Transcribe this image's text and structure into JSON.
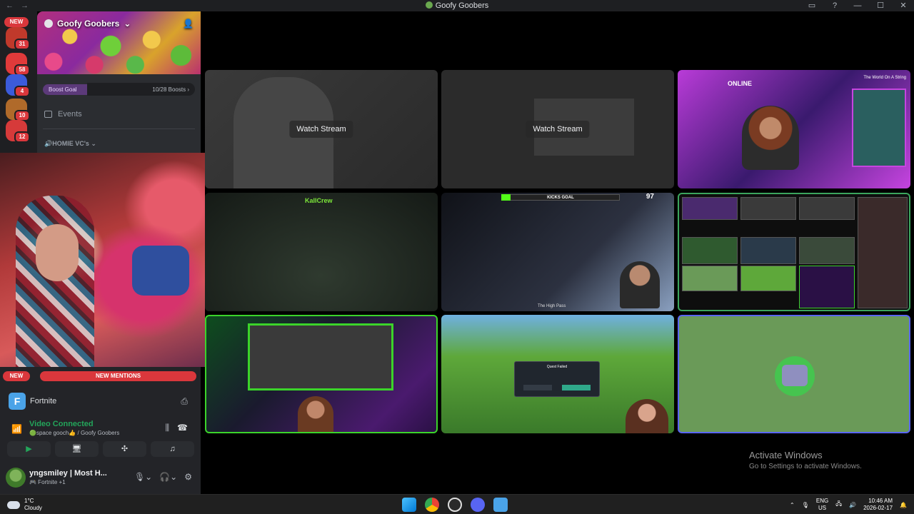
{
  "titlebar": {
    "back": "←",
    "forward": "→",
    "title": "Goofy Goobers",
    "inbox_icon": "inbox-icon",
    "help": "?",
    "minimize": "—",
    "maximize": "☐",
    "close": "✕"
  },
  "rail": {
    "new_label": "NEW",
    "servers": [
      {
        "badge": "31",
        "color": "#c0392b"
      },
      {
        "badge": "58",
        "color": "#e03a3a"
      },
      {
        "badge": "4",
        "color": "#3b5bdb"
      },
      {
        "badge": "10",
        "color": "#b06a2a"
      },
      {
        "badge": "12",
        "color": "#d63a3a"
      }
    ]
  },
  "sidebar": {
    "server_name": "Goofy Goobers",
    "invite_icon": "add-member-icon",
    "boost_goal_label": "Boost Goal",
    "boost_count": "10/28 Boosts ›",
    "boost_progress": 0.357,
    "events_label": "Events",
    "category_label": "🔊HOMIE VC's ⌄"
  },
  "lower": {
    "new_label": "NEW",
    "mentions_label": "NEW MENTIONS",
    "activity_name": "Fortnite",
    "voice_status": "Video Connected",
    "voice_channel": "🟢space gooch👍 / Goofy Goobers",
    "user_name": "yngsmiley | Most H...",
    "user_status": "🎮 Fortnite +1"
  },
  "streams": {
    "watch_label": "Watch Stream",
    "tile3_online": "ONLINE",
    "tile3_caption": "The World On A String",
    "tile4_logo": "KallCrew",
    "tile5_goal": "KICKS GOAL",
    "tile5_goal_progress": 0.08,
    "tile5_count": "97",
    "tile5_location": "The High Pass",
    "tile8_dialog": "Quest Failed"
  },
  "watermark": {
    "line1": "Activate Windows",
    "line2": "Go to Settings to activate Windows."
  },
  "taskbar": {
    "temp": "1°C",
    "condition": "Cloudy",
    "lang_top": "ENG",
    "lang_bottom": "US",
    "time": "10:46 AM",
    "date": "2026-02-17"
  }
}
